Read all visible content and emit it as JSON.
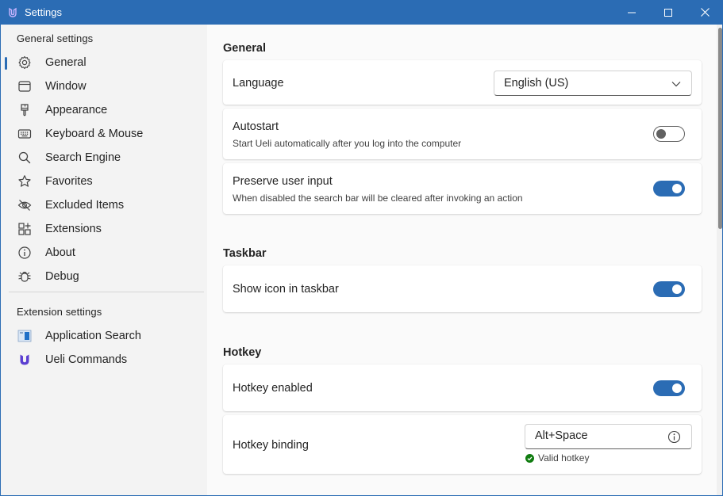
{
  "window": {
    "title": "Settings",
    "accent": "#2b6cb4",
    "controls": [
      "minimize-icon",
      "maximize-icon",
      "close-icon"
    ]
  },
  "sidebar": {
    "general_title": "General settings",
    "general_items": [
      {
        "label": "General",
        "icon": "gear-icon",
        "active": true
      },
      {
        "label": "Window",
        "icon": "window-icon"
      },
      {
        "label": "Appearance",
        "icon": "paint-brush-icon"
      },
      {
        "label": "Keyboard & Mouse",
        "icon": "keyboard-icon"
      },
      {
        "label": "Search Engine",
        "icon": "search-icon"
      },
      {
        "label": "Favorites",
        "icon": "star-icon"
      },
      {
        "label": "Excluded Items",
        "icon": "eye-off-icon"
      },
      {
        "label": "Extensions",
        "icon": "apps-add-icon"
      },
      {
        "label": "About",
        "icon": "info-icon"
      },
      {
        "label": "Debug",
        "icon": "bug-icon"
      }
    ],
    "extension_title": "Extension settings",
    "extension_items": [
      {
        "label": "Application Search",
        "icon": "application-search-icon"
      },
      {
        "label": "Ueli Commands",
        "icon": "ueli-logo-icon"
      }
    ]
  },
  "main": {
    "general": {
      "title": "General",
      "language": {
        "label": "Language",
        "value": "English (US)"
      },
      "autostart": {
        "label": "Autostart",
        "description": "Start Ueli automatically after you log into the computer",
        "enabled": false
      },
      "preserve_input": {
        "label": "Preserve user input",
        "description": "When disabled the search bar will be cleared after invoking an action",
        "enabled": true
      }
    },
    "taskbar": {
      "title": "Taskbar",
      "show_icon": {
        "label": "Show icon in taskbar",
        "enabled": true
      }
    },
    "hotkey": {
      "title": "Hotkey",
      "enabled": {
        "label": "Hotkey enabled",
        "enabled": true
      },
      "binding": {
        "label": "Hotkey binding",
        "value": "Alt+Space",
        "validation": "Valid hotkey"
      }
    }
  },
  "colors": {
    "toggle_on": "#2b6cb4",
    "valid_green": "#107c10"
  }
}
